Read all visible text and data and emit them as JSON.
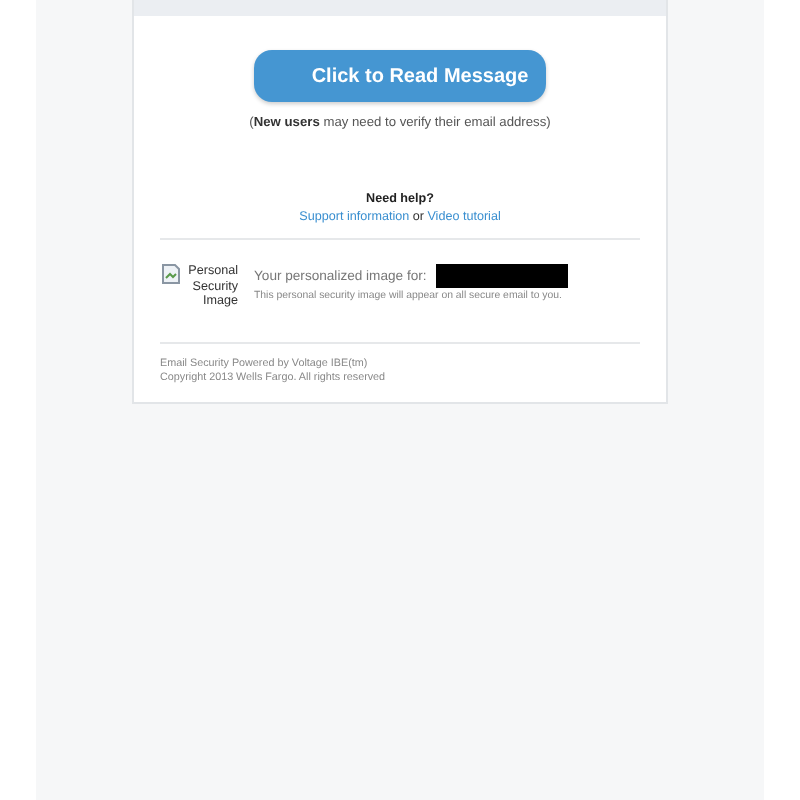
{
  "button": {
    "label": "Click to Read Message"
  },
  "note": "(**New users** may need to verify their email address)",
  "help": {
    "title": "Need help?",
    "links": [
      "Support information",
      "Video tutorial"
    ],
    "joiner": "or"
  },
  "security": {
    "image_alt": "Personal Security Image",
    "label": "Your personalized image for:",
    "redacted": true,
    "description": "This personal security image will appear on all secure email to you."
  },
  "footer": [
    "Email Security Powered by Voltage IBE(tm)",
    "Copyright 2013 Wells Fargo. All rights reserved"
  ]
}
